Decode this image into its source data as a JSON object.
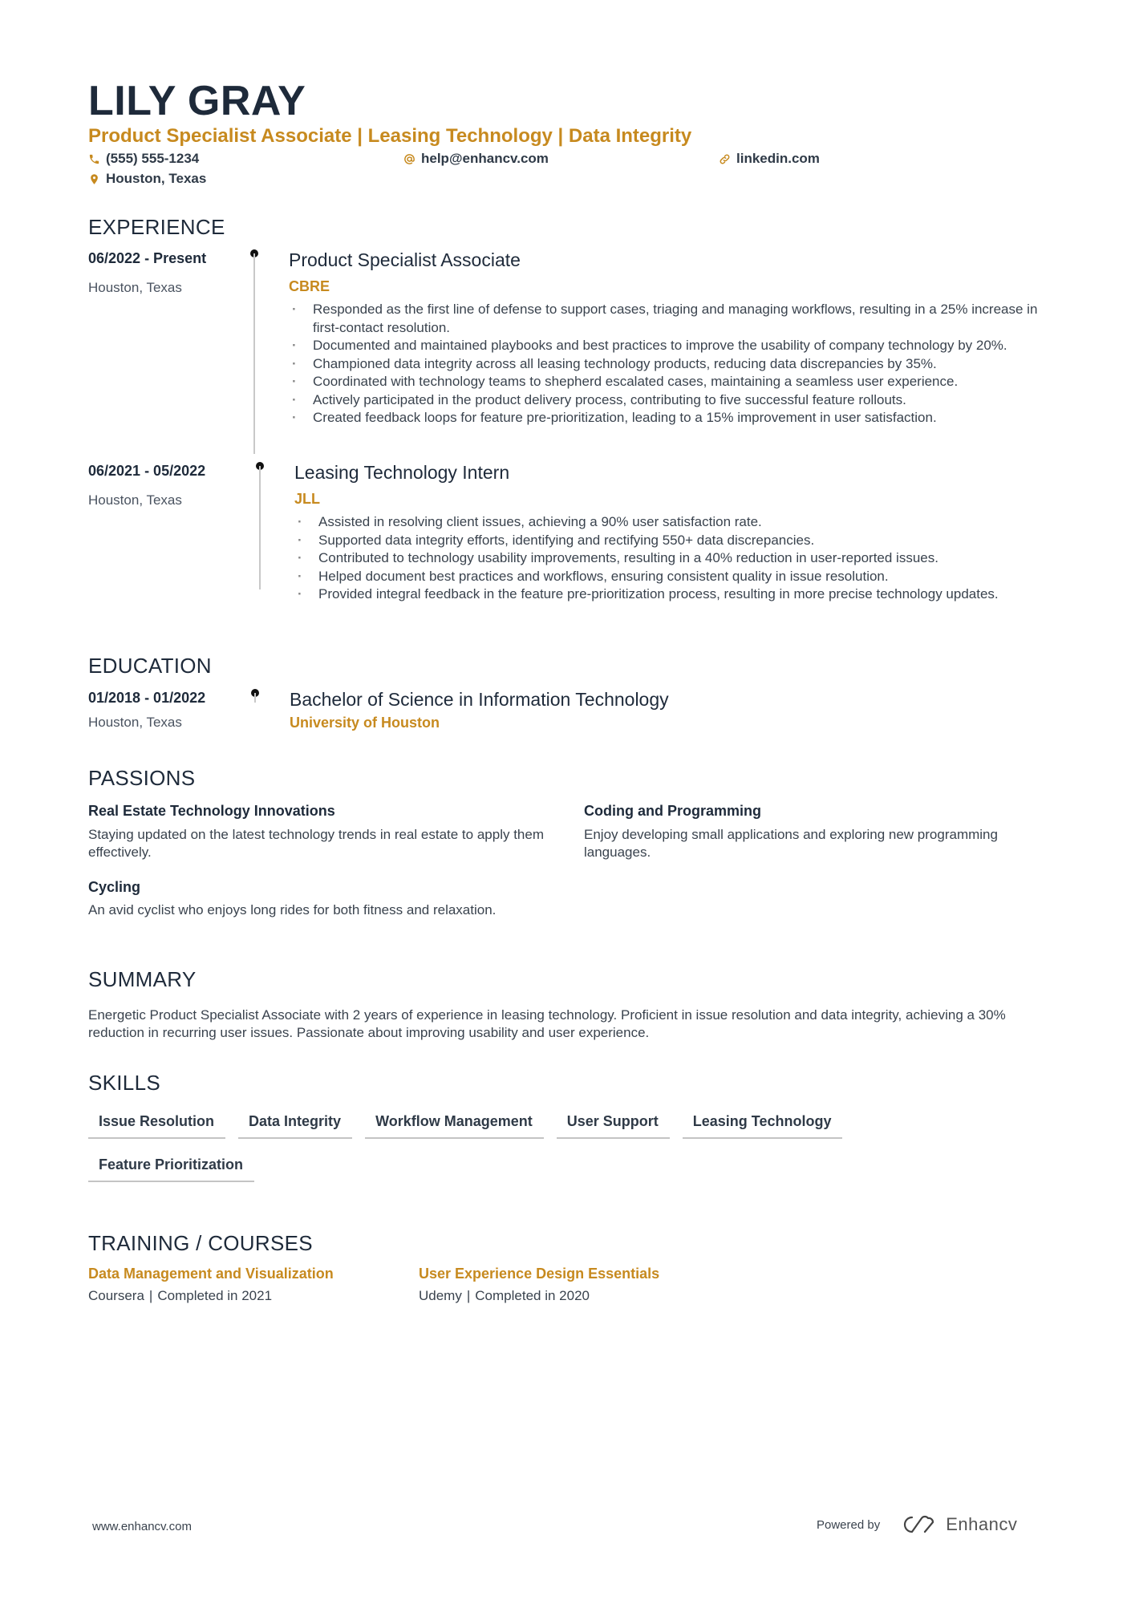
{
  "header": {
    "name": "LILY GRAY",
    "headline": "Product Specialist Associate | Leasing Technology | Data Integrity",
    "phone": "(555) 555-1234",
    "email": "help@enhancv.com",
    "website": "linkedin.com",
    "location": "Houston, Texas",
    "accent_color": "#c78a1f"
  },
  "experience": {
    "title": "EXPERIENCE",
    "items": [
      {
        "dates": "06/2022 - Present",
        "location": "Houston, Texas",
        "role": "Product Specialist Associate",
        "company": "CBRE",
        "bullets": [
          "Responded as the first line of defense to support cases, triaging and managing workflows, resulting in a 25% increase in first-contact resolution.",
          "Documented and maintained playbooks and best practices to improve the usability of company technology by 20%.",
          "Championed data integrity across all leasing technology products, reducing data discrepancies by 35%.",
          "Coordinated with technology teams to shepherd escalated cases, maintaining a seamless user experience.",
          "Actively participated in the product delivery process, contributing to five successful feature rollouts.",
          "Created feedback loops for feature pre-prioritization, leading to a 15% improvement in user satisfaction."
        ]
      },
      {
        "dates": "06/2021 - 05/2022",
        "location": "Houston, Texas",
        "role": "Leasing Technology Intern",
        "company": "JLL",
        "bullets": [
          "Assisted in resolving client issues, achieving a 90% user satisfaction rate.",
          "Supported data integrity efforts, identifying and rectifying 550+ data discrepancies.",
          "Contributed to technology usability improvements, resulting in a 40% reduction in user-reported issues.",
          "Helped document best practices and workflows, ensuring consistent quality in issue resolution.",
          "Provided integral feedback in the feature pre-prioritization process, resulting in more precise technology updates."
        ]
      }
    ]
  },
  "education": {
    "title": "EDUCATION",
    "items": [
      {
        "dates": "01/2018 - 01/2022",
        "location": "Houston, Texas",
        "degree": "Bachelor of Science in Information Technology",
        "school": "University of Houston"
      }
    ]
  },
  "passions": {
    "title": "PASSIONS",
    "items": [
      {
        "title": "Real Estate Technology Innovations",
        "description": "Staying updated on the latest technology trends in real estate to apply them effectively."
      },
      {
        "title": "Coding and Programming",
        "description": "Enjoy developing small applications and exploring new programming languages."
      },
      {
        "title": "Cycling",
        "description": "An avid cyclist who enjoys long rides for both fitness and relaxation."
      }
    ]
  },
  "summary": {
    "title": "SUMMARY",
    "text": "Energetic Product Specialist Associate with 2 years of experience in leasing technology. Proficient in issue resolution and data integrity, achieving a 30% reduction in recurring user issues. Passionate about improving usability and user experience."
  },
  "skills": {
    "title": "SKILLS",
    "items": [
      "Issue Resolution",
      "Data Integrity",
      "Workflow Management",
      "User Support",
      "Leasing Technology",
      "Feature Prioritization"
    ]
  },
  "training": {
    "title": "TRAINING / COURSES",
    "items": [
      {
        "title": "Data Management and Visualization",
        "provider": "Coursera",
        "completed": "Completed in 2021"
      },
      {
        "title": "User Experience Design Essentials",
        "provider": "Udemy",
        "completed": "Completed in 2020"
      }
    ]
  },
  "footer": {
    "website": "www.enhancv.com",
    "powered_by": "Powered by",
    "brand": "Enhancv"
  }
}
